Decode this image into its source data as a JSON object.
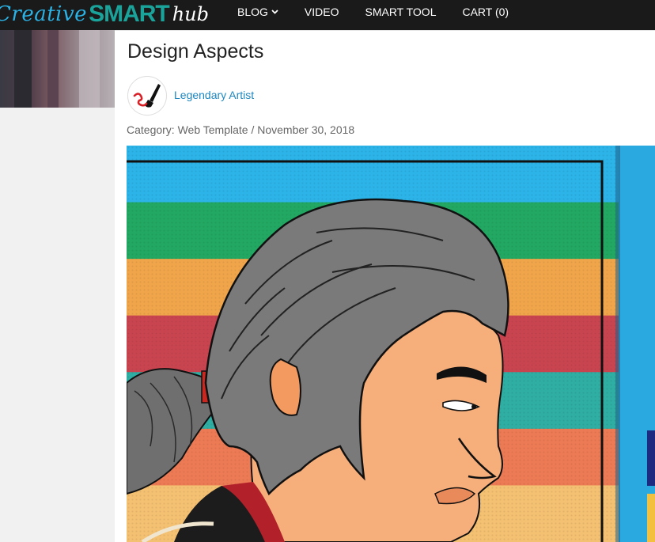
{
  "logo": {
    "part1": "Creative",
    "part2": "SMART",
    "part3": "hub"
  },
  "nav": {
    "items": [
      {
        "label": "BLOG",
        "has_dropdown": true
      },
      {
        "label": "VIDEO"
      },
      {
        "label": "SMART TOOL"
      },
      {
        "label": "CART (0)"
      }
    ]
  },
  "post": {
    "title": "Design Aspects",
    "author": "Legendary Artist",
    "category_line": "Category: Web Template / November 30, 2018"
  },
  "colors": {
    "header_bg": "#1a1a1a",
    "author_link": "#1e87c0",
    "stripes": [
      "#2cb3e8",
      "#22a862",
      "#f0a54a",
      "#c84550",
      "#2faea3",
      "#ec7a54",
      "#f4c071"
    ]
  },
  "icons": {
    "avatar": "paintbrush-icon",
    "dropdown": "chevron-down-icon"
  }
}
